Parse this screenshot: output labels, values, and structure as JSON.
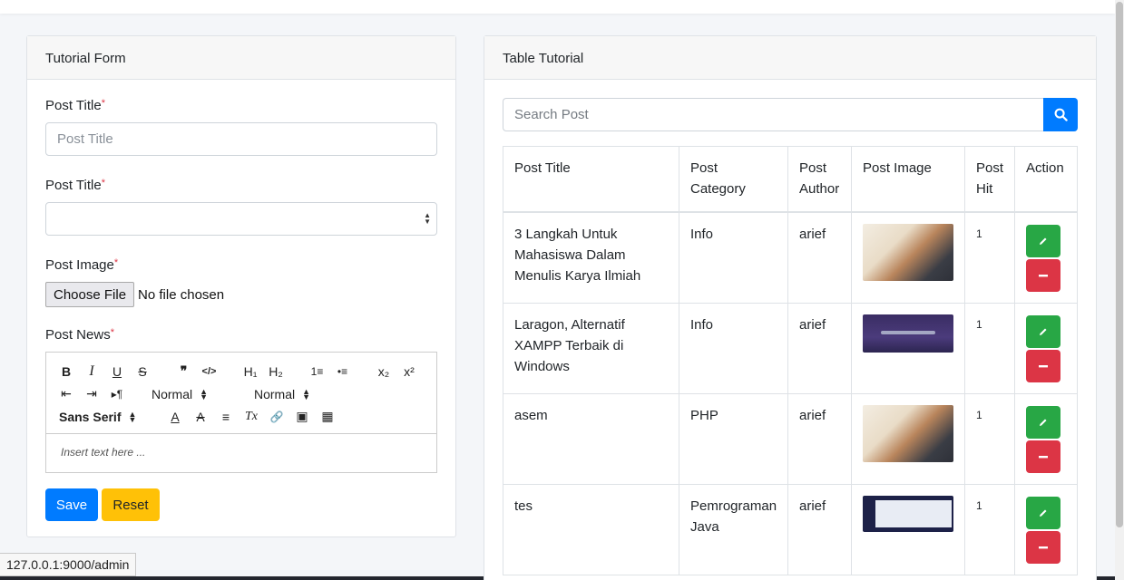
{
  "form": {
    "title": "Tutorial Form",
    "post_title_label": "Post Title",
    "post_title_placeholder": "Post Title",
    "post_category_label": "Post Title",
    "post_image_label": "Post Image",
    "file_button": "Choose File",
    "file_status": "No file chosen",
    "post_news_label": "Post News",
    "required_mark": "*",
    "editor": {
      "bold": "B",
      "italic": "I",
      "underline": "U",
      "strike": "S",
      "blockquote": "❞",
      "code": "</>",
      "h1": "H₁",
      "h2": "H₂",
      "ordered_list": "1≡",
      "bullet_list": "•≡",
      "subscript": "x₂",
      "superscript": "x²",
      "outdent": "⇤",
      "indent": "⇥",
      "rtl": "▸¶",
      "size_picker": "Normal",
      "header_picker": "Normal",
      "font_picker": "Sans Serif",
      "color": "A",
      "background": "A",
      "align": "≡",
      "clean": "Tx",
      "link": "🔗",
      "image": "▣",
      "video": "▦",
      "placeholder": "Insert text here ..."
    },
    "save_label": "Save",
    "reset_label": "Reset"
  },
  "table": {
    "title": "Table Tutorial",
    "search_placeholder": "Search Post",
    "headers": {
      "title": "Post Title",
      "category": "Post Category",
      "author": "Post Author",
      "image": "Post Image",
      "hit": "Post Hit",
      "action": "Action"
    },
    "rows": [
      {
        "title": "3 Langkah Untuk Mahasiswa Dalam Menulis Karya Ilmiah",
        "category": "Info",
        "author": "arief",
        "image": "writing-photo",
        "hit": "1"
      },
      {
        "title": "Laragon, Alternatif XAMPP Terbaik di Windows",
        "category": "Info",
        "author": "arief",
        "image": "laragon-screenshot",
        "hit": "1"
      },
      {
        "title": "asem",
        "category": "PHP",
        "author": "arief",
        "image": "writing-photo",
        "hit": "1"
      },
      {
        "title": "tes",
        "category": "Pemrograman Java",
        "author": "arief",
        "image": "app-screenshot",
        "hit": "1"
      }
    ]
  },
  "status_bar": {
    "url": "127.0.0.1:9000/admin"
  },
  "colors": {
    "primary": "#007bff",
    "warning": "#ffc107",
    "success": "#28a745",
    "danger": "#dc3545"
  }
}
